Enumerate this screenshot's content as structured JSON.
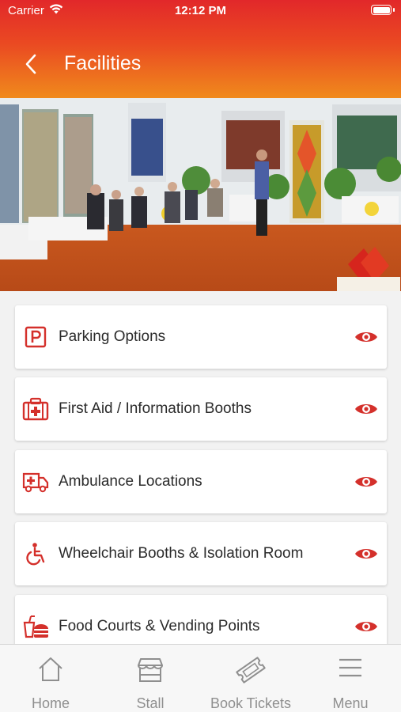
{
  "status_bar": {
    "carrier": "Carrier",
    "time": "12:12 PM"
  },
  "header": {
    "title": "Facilities"
  },
  "facilities": [
    {
      "label": "Parking Options",
      "icon": "parking-icon"
    },
    {
      "label": "First Aid / Information Booths",
      "icon": "first-aid-icon"
    },
    {
      "label": "Ambulance Locations",
      "icon": "ambulance-icon"
    },
    {
      "label": "Wheelchair Booths & Isolation Room",
      "icon": "wheelchair-icon"
    },
    {
      "label": "Food Courts & Vending Points",
      "icon": "food-court-icon"
    }
  ],
  "tabs": [
    {
      "label": "Home",
      "icon": "home-icon"
    },
    {
      "label": "Stall",
      "icon": "stall-icon"
    },
    {
      "label": "Book Tickets",
      "icon": "ticket-icon"
    },
    {
      "label": "Menu",
      "icon": "menu-icon"
    }
  ],
  "colors": {
    "accent": "#d4302b",
    "header_top": "#e2282a",
    "header_bottom": "#f08a1c",
    "tab_inactive": "#8f8f8f"
  }
}
